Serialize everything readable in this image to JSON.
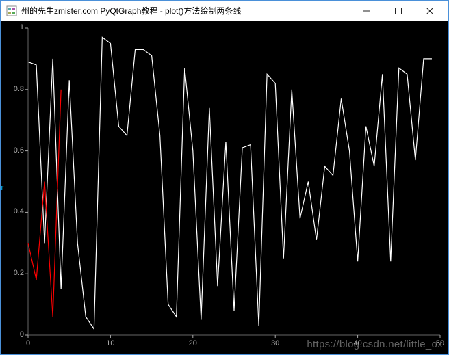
{
  "window": {
    "title": "州的先生zmister.com PyQtGraph教程 - plot()方法绘制两条线",
    "min_tip": "Minimize",
    "max_tip": "Maximize",
    "close_tip": "Close"
  },
  "y_axis_clipped_label": "r",
  "watermark": "https://blog.csdn.net/little_ox",
  "chart_data": {
    "type": "line",
    "xlabel": "",
    "ylabel": "",
    "xlim": [
      0,
      50
    ],
    "ylim": [
      0,
      1
    ],
    "x_ticks": [
      0,
      10,
      20,
      30,
      40,
      50
    ],
    "y_ticks": [
      0,
      0.2,
      0.4,
      0.6,
      0.8,
      1
    ],
    "series": [
      {
        "name": "white",
        "color": "#ffffff",
        "x": [
          0,
          1,
          2,
          3,
          4,
          5,
          6,
          7,
          8,
          9,
          10,
          11,
          12,
          13,
          14,
          15,
          16,
          17,
          18,
          19,
          20,
          21,
          22,
          23,
          24,
          25,
          26,
          27,
          28,
          29,
          30,
          31,
          32,
          33,
          34,
          35,
          36,
          37,
          38,
          39,
          40,
          41,
          42,
          43,
          44,
          45,
          46,
          47,
          48,
          49
        ],
        "values": [
          0.89,
          0.88,
          0.3,
          0.9,
          0.15,
          0.83,
          0.3,
          0.06,
          0.02,
          0.97,
          0.95,
          0.68,
          0.65,
          0.93,
          0.93,
          0.91,
          0.65,
          0.1,
          0.06,
          0.87,
          0.6,
          0.05,
          0.74,
          0.16,
          0.63,
          0.08,
          0.61,
          0.62,
          0.03,
          0.85,
          0.82,
          0.25,
          0.8,
          0.38,
          0.5,
          0.31,
          0.55,
          0.52,
          0.77,
          0.6,
          0.24,
          0.68,
          0.55,
          0.85,
          0.24,
          0.87,
          0.85,
          0.57,
          0.9,
          0.9
        ]
      },
      {
        "name": "red",
        "color": "#ff0000",
        "x": [
          0,
          1,
          2,
          3,
          4
        ],
        "values": [
          0.3,
          0.18,
          0.5,
          0.06,
          0.8
        ]
      }
    ]
  }
}
